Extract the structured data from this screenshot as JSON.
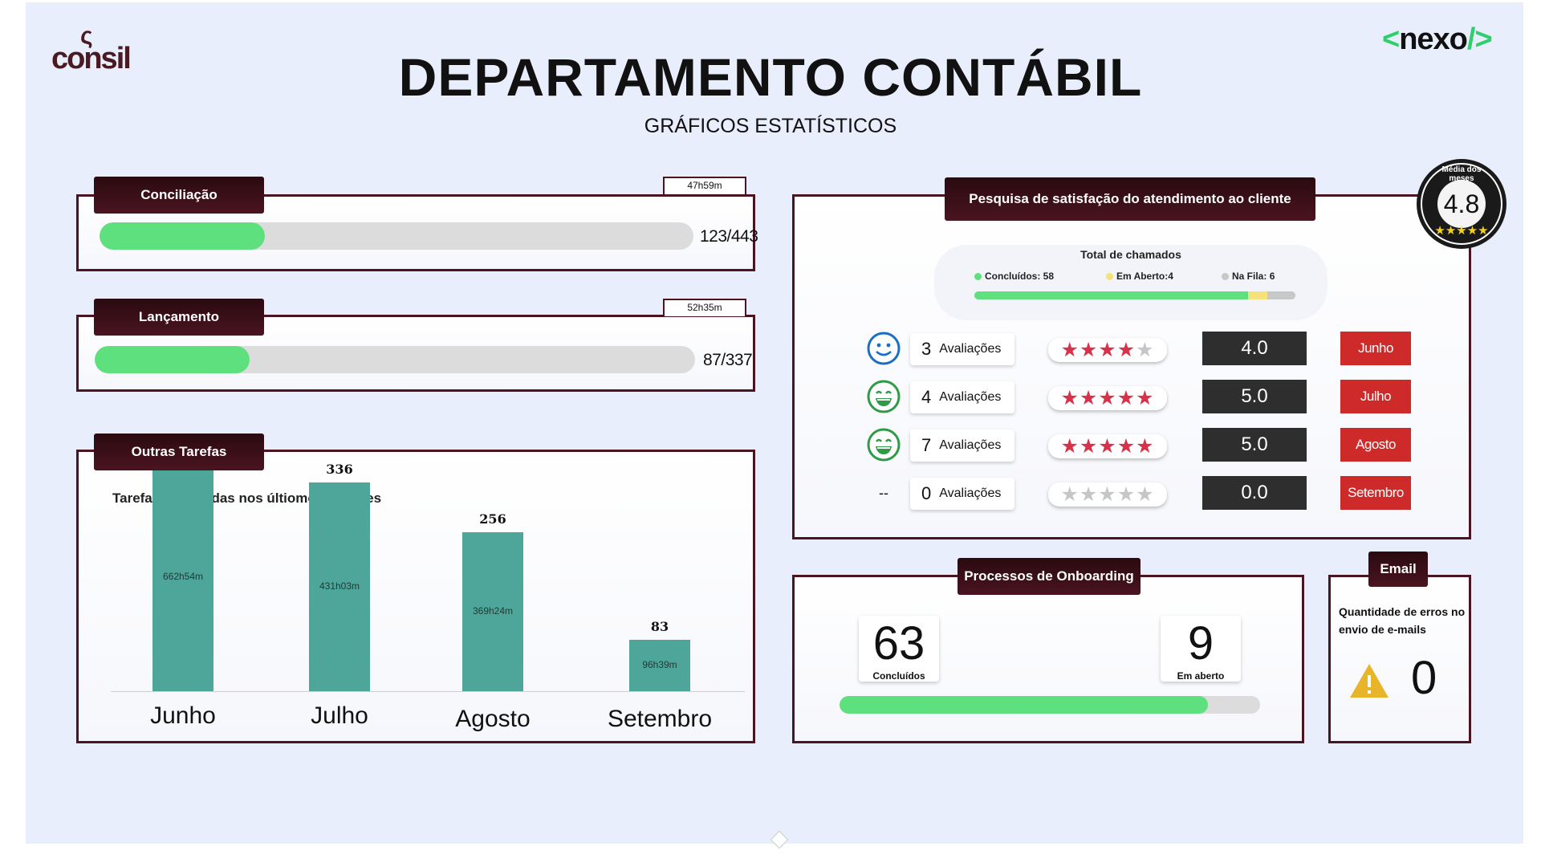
{
  "brand": {
    "consil_mark": "ς",
    "consil_word": "consil",
    "nexo_open": "<",
    "nexo_word": "nexo",
    "nexo_close": "/>"
  },
  "header": {
    "title": "DEPARTAMENTO CONTÁBIL",
    "subtitle": "GRÁFICOS ESTATÍSTICOS"
  },
  "conciliacao": {
    "label": "Conciliação",
    "time": "47h59m",
    "ratio": "123/443",
    "progress": 0.278
  },
  "lancamento": {
    "label": "Lançamento",
    "time": "52h35m",
    "ratio": "87/337",
    "progress": 0.258
  },
  "outras": {
    "label": "Outras Tarefas",
    "chart_subtitle": "Tarefas concluídas nos últiomos 4 meses"
  },
  "chart_data": {
    "type": "bar",
    "title": "Tarefas concluídas nos últiomos 4 meses",
    "categories": [
      "Junho",
      "Julho",
      "Agosto",
      "Setembro"
    ],
    "values": [
      367,
      336,
      256,
      83
    ],
    "durations": [
      "662h54m",
      "431h03m",
      "369h24m",
      "96h39m"
    ],
    "ylim": [
      0,
      400
    ],
    "grid": false
  },
  "satisfacao": {
    "label": "Pesquisa de satisfação do atendimento ao cliente",
    "media_caption": "Média dos meses",
    "media_value": "4.8",
    "media_stars": "★★★★★",
    "chamados": {
      "title": "Total de chamados",
      "concluidos_label": "Concluídos:",
      "concluidos": 58,
      "em_aberto_label": "Em Aberto:",
      "em_aberto": 4,
      "na_fila_label": "Na Fila:",
      "na_fila": 6
    },
    "rows": [
      {
        "face": "smile-face-icon",
        "count": "3",
        "word": "Avaliações",
        "stars": 4,
        "score": "4.0",
        "month": "Junho"
      },
      {
        "face": "grin-face-icon",
        "count": "4",
        "word": "Avaliações",
        "stars": 5,
        "score": "5.0",
        "month": "Julho"
      },
      {
        "face": "grin-face-icon",
        "count": "7",
        "word": "Avaliações",
        "stars": 5,
        "score": "5.0",
        "month": "Agosto"
      },
      {
        "face": "none",
        "face_text": "--",
        "count": "0",
        "word": "Avaliações",
        "stars": 0,
        "score": "0.0",
        "month": "Setembro"
      }
    ]
  },
  "onboarding": {
    "label": "Processos de Onboarding",
    "concluidos": "63",
    "concluidos_label": "Concluídos",
    "em_aberto": "9",
    "em_aberto_label": "Em aberto",
    "progress": 0.875
  },
  "email": {
    "label": "Email",
    "desc": "Quantidade de erros no envio de e-mails",
    "errors": "0",
    "icon": "warning-icon"
  },
  "colors": {
    "panel_border": "#4a1420",
    "tab_bg": "#3a0e16",
    "progress_green": "#5fe07e",
    "bar_teal": "#4ea69a",
    "star_red": "#d8324a",
    "month_red": "#cf2a2a",
    "score_dark": "#2e2e2e",
    "pending_yellow": "#f5e27a",
    "queue_grey": "#c8c8c8",
    "nexo_green": "#2ecf6c"
  }
}
